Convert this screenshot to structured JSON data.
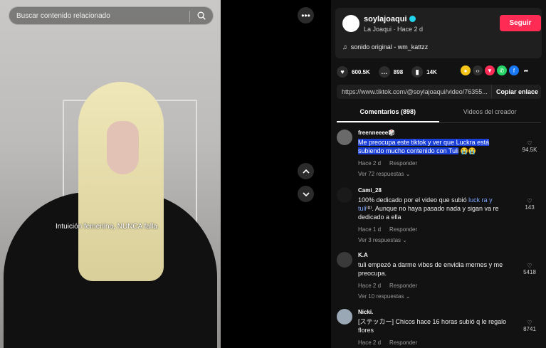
{
  "video": {
    "search_placeholder": "Buscar contenido relacionado",
    "caption": "Intuición femenina, NUNCA  falla."
  },
  "author": {
    "username": "soylajoaqui",
    "subline": "La Joaqui · Hace 2 d",
    "follow_label": "Seguir",
    "sound": "sonido original - wm_kattzz"
  },
  "stats": {
    "likes": "600.5K",
    "comments": "898",
    "saves": "14K"
  },
  "share_link": {
    "url": "https://www.tiktok.com/@soylajoaqui/video/76355...",
    "copy_label": "Copiar enlace"
  },
  "tabs": [
    {
      "label": "Comentarios (898)"
    },
    {
      "label": "Videos del creador"
    }
  ],
  "comments": [
    {
      "user": "freenneeee🎲",
      "text_highlighted": "Me preocupa este tiktok y ver que Luckra está subiendo mucho contenido con Tuli",
      "text_rest": " 😭😭",
      "time": "Hace 2 d",
      "reply": "Responder",
      "likes": "94.5K",
      "replies": "Ver 72 respuestas"
    },
    {
      "user": "Cami_28",
      "text_a": "100% dedicado por el video que subió ",
      "text_link": "luck ra y tuli",
      "text_b": "⁽ᴽ⁾. Aunque no haya pasado nada y sigan va re dedicado a ella",
      "time": "Hace 1 d",
      "reply": "Responder",
      "likes": "143",
      "replies": "Ver 3 respuestas"
    },
    {
      "user": "K.A",
      "text": "tuli empezó a darme vibes de envidia mernes y me preocupa.",
      "time": "Hace 2 d",
      "reply": "Responder",
      "likes": "5418",
      "replies": "Ver 10 respuestas"
    },
    {
      "user": "Nicki.",
      "text": "[ステッカー] Chicos hace 16 horas subió q le regalo flores",
      "time": "Hace 2 d",
      "reply": "Responder",
      "likes": "8741"
    }
  ],
  "colors": {
    "follow": "#fe2c55",
    "highlight": "#1a3fd6",
    "verified": "#20d5ec"
  }
}
